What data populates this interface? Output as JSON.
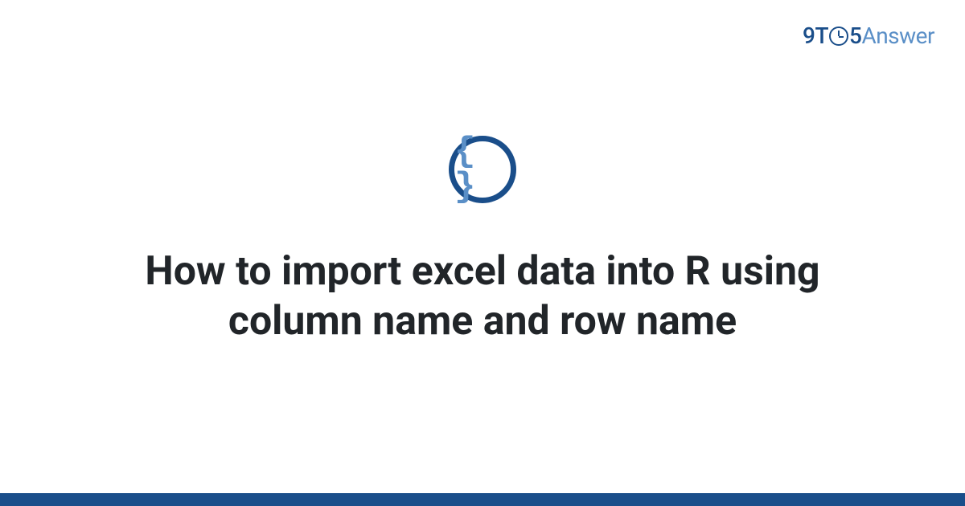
{
  "logo": {
    "part1": "9T",
    "part2": "5",
    "part3": "Answer"
  },
  "icon": {
    "braces": "{ }"
  },
  "title": "How to import excel data into R using column name and row name",
  "colors": {
    "primary": "#1a4e8a",
    "secondary": "#5a8fc7",
    "text": "#212529"
  }
}
